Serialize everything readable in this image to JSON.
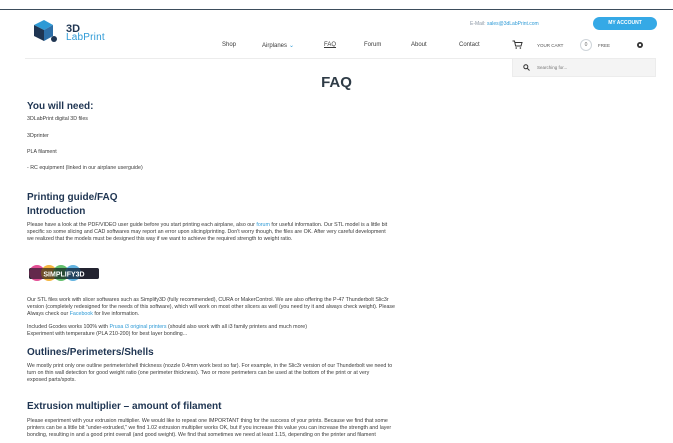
{
  "header": {
    "logo_line1": "3D",
    "logo_line2": "LabPrint",
    "email_prefix": "E-Mail: ",
    "email": "sales@3dLabPrint.com",
    "account_button": "MY ACCOUNT",
    "nav": [
      {
        "label": "Shop"
      },
      {
        "label": "Airplanes",
        "caret": "⌄"
      },
      {
        "label": "FAQ"
      },
      {
        "label": "Forum"
      },
      {
        "label": "About"
      },
      {
        "label": "Contact"
      }
    ],
    "cart_label": "YOUR CART",
    "cart_count": "0",
    "cart_price": "FREE",
    "search_placeholder": "Searching for..."
  },
  "page": {
    "title": "FAQ"
  },
  "need": {
    "heading": "You will need:",
    "items": [
      "3DLabPrint digital 3D files",
      "3Dprinter",
      "PLA filament",
      "- RC equipment (linked in our airplane userguide)"
    ]
  },
  "guide": {
    "heading": "Printing guide/FAQ",
    "intro_heading": "Introduction",
    "intro_text_1": "Please have a look at the PDF/VIDEO user guide before you start printing each airplane, also our ",
    "intro_link": "forum",
    "intro_text_2": " for useful information. Our STL model is a little bit",
    "intro_line2": "specific so some slicing and CAD softwares may report an error upon slicing/printing. Don't worry though, the files are OK. After very careful development",
    "intro_line3": "we realized that the models must be designed this way if we want to achieve the required strength to weight ratio.",
    "simplify_logo_text": "SIMPLIFY3D",
    "stl_line1": "Our STL files work with slicer softwares such as Simplify3D (fully recommended), CURA or MakerControl. We are also offering the P-47 Thunderbolt Slic3r",
    "stl_line2": "version (completely redesigned for the needs of this software), which will work on most other slicers as well (you need try it and always check weight). Please",
    "stl_line3_a": "Always check our ",
    "stl_line3_link": "Facebook",
    "stl_line3_b": " for live information.",
    "gcode_a": "Included Gcodes works 100% with ",
    "gcode_link": "Prusa i3 original printers",
    "gcode_b": " (should also work with all i3 family printers and much more)",
    "gcode_line2": "Experiment with temperature (PLA 210-200) for best layer bonding..."
  },
  "outlines": {
    "heading": "Outlines/Perimeters/Shells",
    "line1": "We mostly print only one outline perimeter/shell thickness (nozzle 0.4mm work best so far). For example, in the Slic3r version of our Thunderbolt we need to",
    "line2": "turn on thin wall detection for good weight ratio (one perimeter thickness). Two or more perimeters can be used at the bottom of the print or at very",
    "line3": "exposed parts/spots."
  },
  "extrusion": {
    "heading": "Extrusion multiplier – amount of filament",
    "line1": "Please experiment with your extrusion multiplier. We would like to repeat one IMPORTANT thing for the success of your prints. Because we find that some",
    "line2": "printers can be a little bit \"under-extruded,\" we find 1.02 extrusion multiplier works OK, but if you increase this value you can increase the strength and layer",
    "line3": "bonding, resulting in and a good print overall (and good weight). We find that sometimes we need at least 1.15, depending on the printer and filament"
  },
  "colors": {
    "accent": "#35a9e6",
    "heading": "#1f3552",
    "link": "#2d9ad6"
  }
}
